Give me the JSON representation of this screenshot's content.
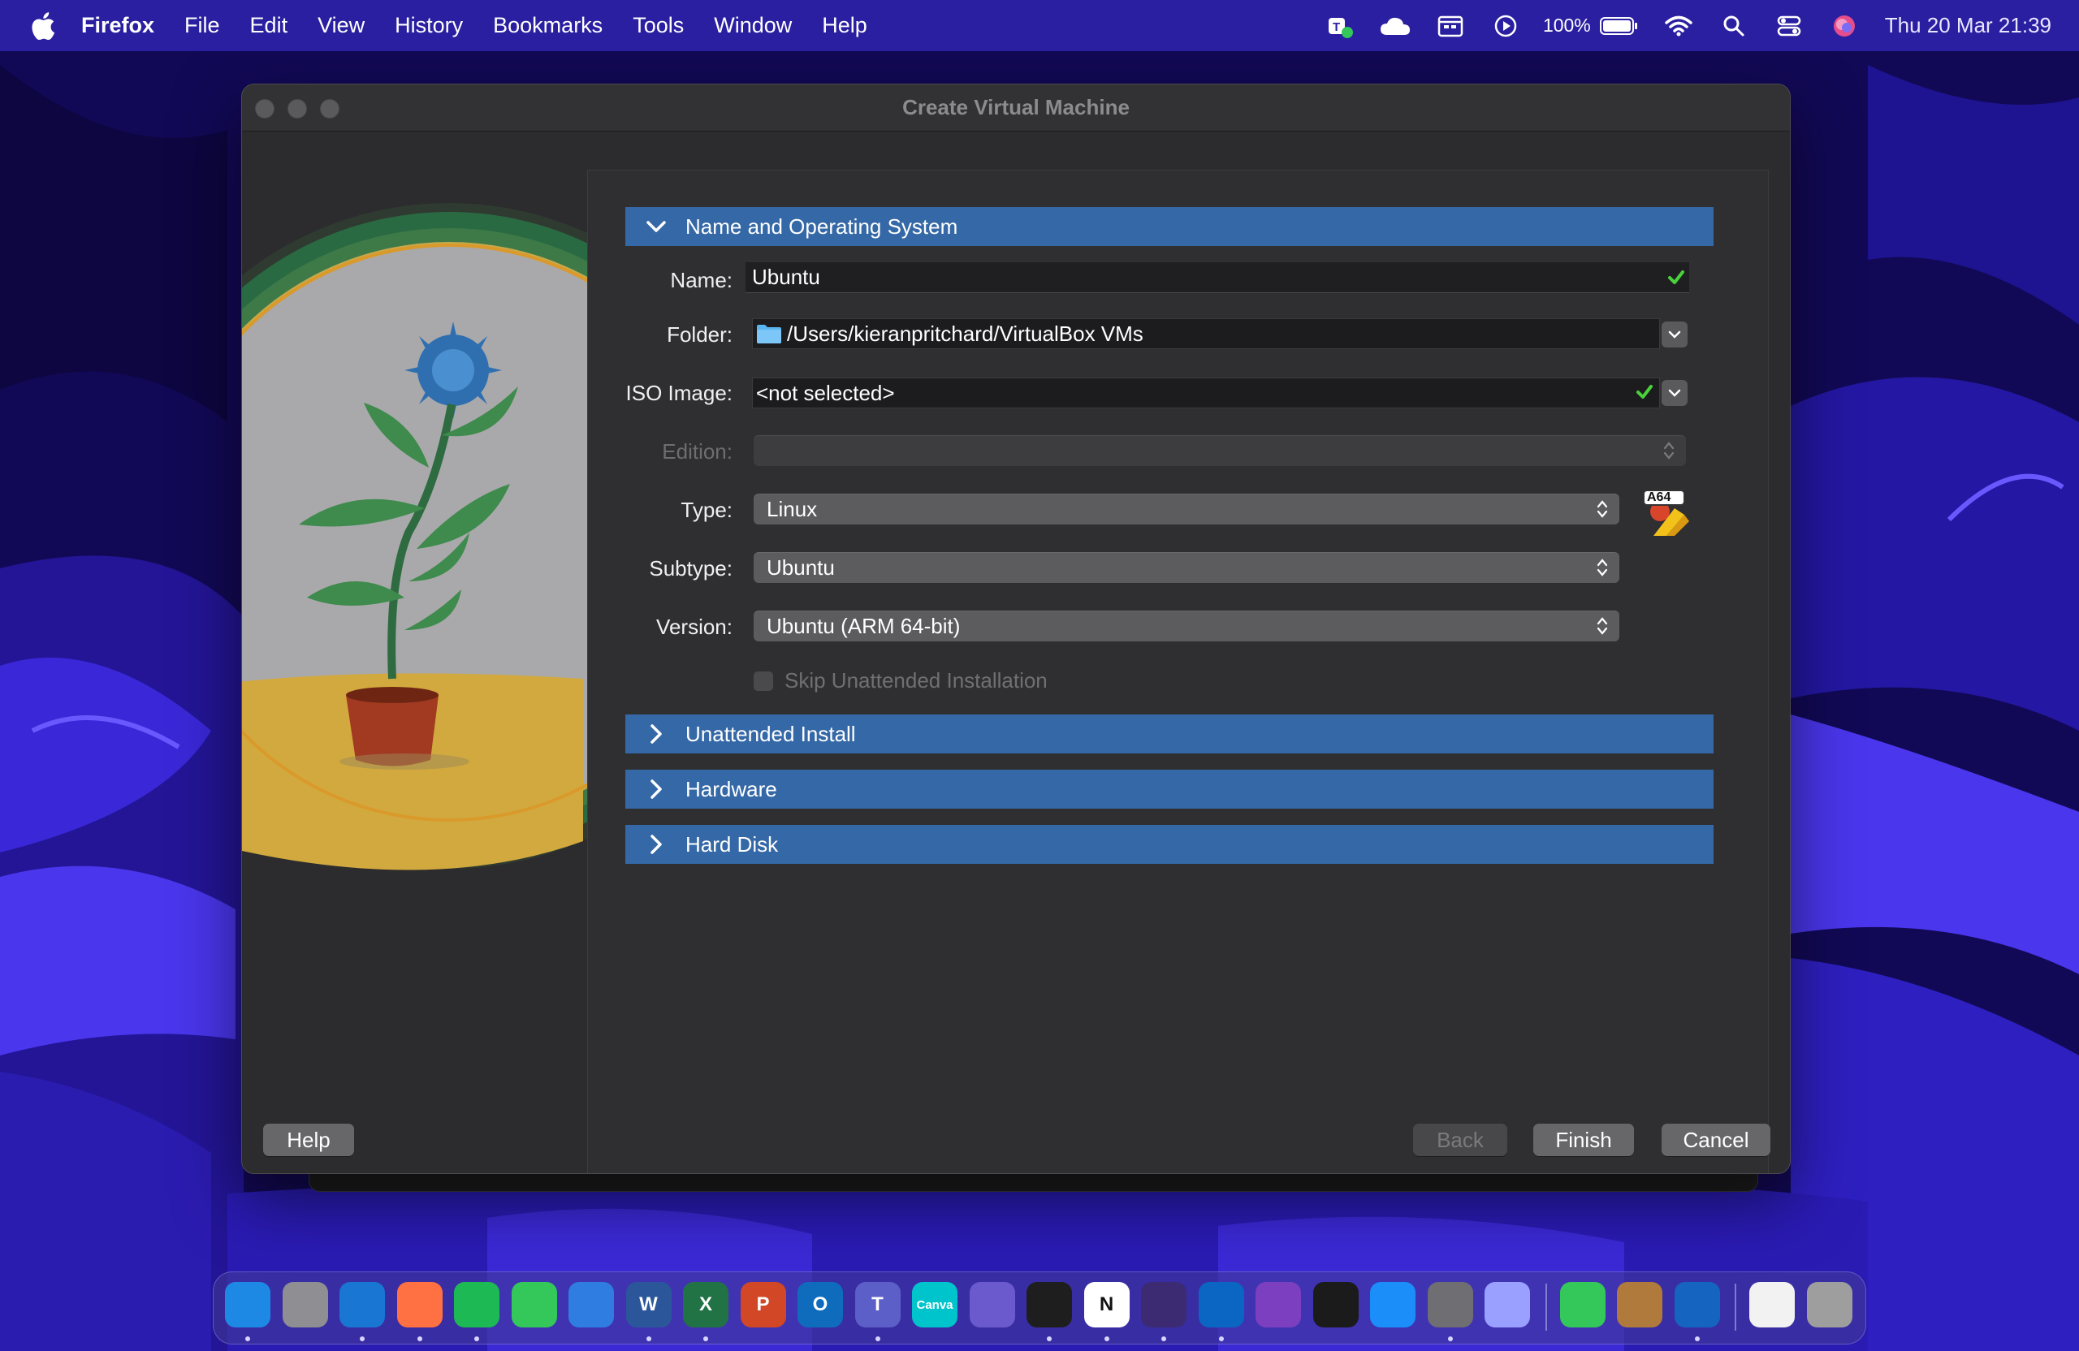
{
  "menubar": {
    "app_name": "Firefox",
    "menus": [
      "File",
      "Edit",
      "View",
      "History",
      "Bookmarks",
      "Tools",
      "Window",
      "Help"
    ],
    "battery_percent": "100%",
    "clock": "Thu 20 Mar  21:39",
    "status_icons": [
      "teams-status-icon",
      "icloud-icon",
      "calendar-icon",
      "play-icon",
      "battery-icon",
      "wifi-icon",
      "search-icon",
      "control-center-icon",
      "siri-icon"
    ]
  },
  "window": {
    "title": "Create Virtual Machine"
  },
  "sections": {
    "name_os": "Name and Operating System",
    "unattended": "Unattended Install",
    "hardware": "Hardware",
    "hard_disk": "Hard Disk"
  },
  "form": {
    "name_label": "Name:",
    "name_value": "Ubuntu",
    "folder_label": "Folder:",
    "folder_value": "/Users/kieranpritchard/VirtualBox VMs",
    "iso_label": "ISO Image:",
    "iso_value": "<not selected>",
    "edition_label": "Edition:",
    "edition_value": "",
    "type_label": "Type:",
    "type_value": "Linux",
    "subtype_label": "Subtype:",
    "subtype_value": "Ubuntu",
    "version_label": "Version:",
    "version_value": "Ubuntu (ARM 64-bit)",
    "skip_unattended_label": "Skip Unattended Installation",
    "skip_unattended_checked": false,
    "os_badge": "A64"
  },
  "buttons": {
    "help": "Help",
    "back": "Back",
    "finish": "Finish",
    "cancel": "Cancel"
  },
  "dock": {
    "apps": [
      {
        "name": "finder",
        "color": "#1e88e5"
      },
      {
        "name": "launchpad",
        "color": "#8e8e93"
      },
      {
        "name": "safari",
        "color": "#1976d2"
      },
      {
        "name": "firefox",
        "color": "#ff7043"
      },
      {
        "name": "spotify",
        "color": "#1db954"
      },
      {
        "name": "messages",
        "color": "#34c759"
      },
      {
        "name": "mail",
        "color": "#2f7de1"
      },
      {
        "name": "word",
        "color": "#2b579a",
        "glyph": "W"
      },
      {
        "name": "excel",
        "color": "#217346",
        "glyph": "X"
      },
      {
        "name": "powerpoint",
        "color": "#d24726",
        "glyph": "P"
      },
      {
        "name": "outlook",
        "color": "#0f6cbd",
        "glyph": "O"
      },
      {
        "name": "teams",
        "color": "#5b5fc7",
        "glyph": "T"
      },
      {
        "name": "canva",
        "color": "#00c4cc",
        "glyph": "Canva"
      },
      {
        "name": "bear-app",
        "color": "#6a5acd"
      },
      {
        "name": "figma",
        "color": "#1e1e1e"
      },
      {
        "name": "notion",
        "color": "#ffffff",
        "glyph": "N"
      },
      {
        "name": "obsidian",
        "color": "#3c2a72"
      },
      {
        "name": "vscode",
        "color": "#0a66c2"
      },
      {
        "name": "github-desktop",
        "color": "#7b3fbf"
      },
      {
        "name": "terminal",
        "color": "#1b1b1b"
      },
      {
        "name": "app-store",
        "color": "#1c8ef9"
      },
      {
        "name": "system-settings",
        "color": "#6e6e73"
      },
      {
        "name": "iphone-mirroring",
        "color": "#9aa0ff"
      },
      {
        "name": "facetime",
        "color": "#34c759"
      },
      {
        "name": "contacts",
        "color": "#b07a3c"
      },
      {
        "name": "virtualbox",
        "color": "#1565c0"
      },
      {
        "name": "preview",
        "color": "#f2f2f2"
      },
      {
        "name": "trash",
        "color": "#9e9e9e"
      }
    ]
  }
}
